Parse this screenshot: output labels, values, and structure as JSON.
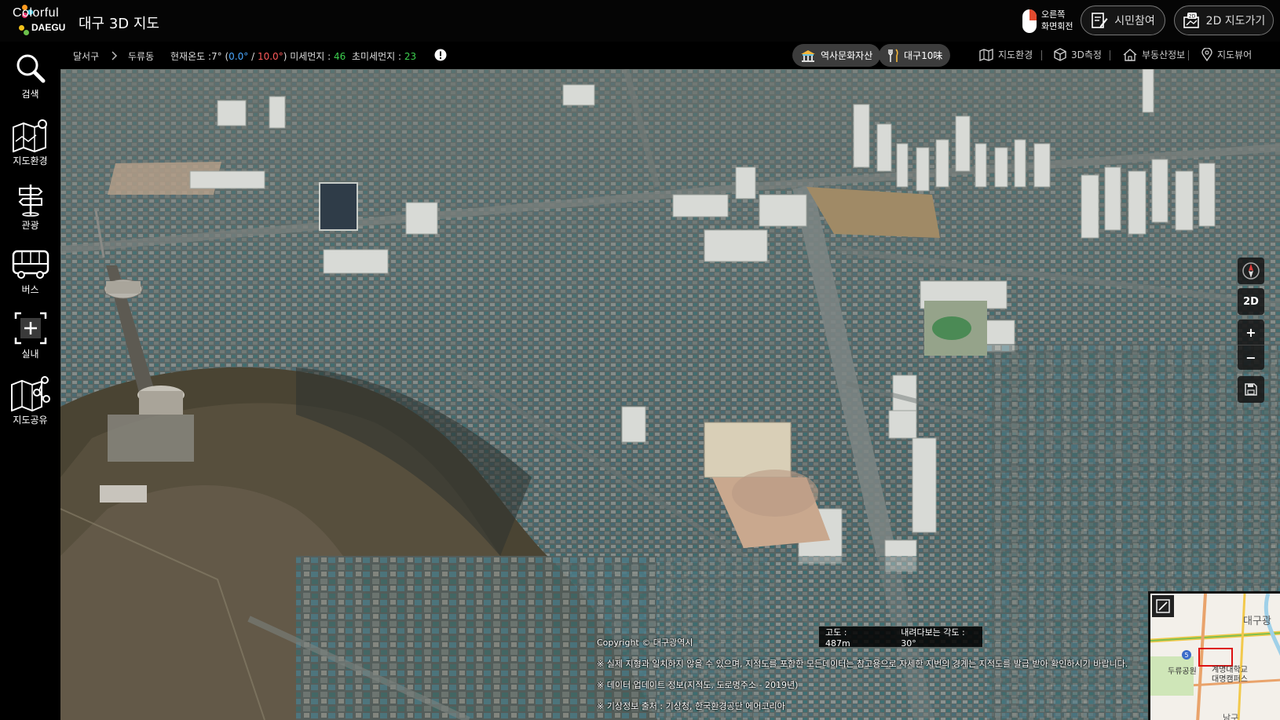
{
  "header": {
    "logo_line1": "Colorful",
    "logo_line2": "DAEGU",
    "title": "대구 3D 지도",
    "rotate_hint_line1": "오른쪽",
    "rotate_hint_line2": "화면회전",
    "citizen_button": "시민참여",
    "goto2d_button": "2D 지도가기",
    "goto2d_badge": "2D"
  },
  "sidebar": {
    "items": [
      {
        "label": "검색",
        "icon": "search-icon"
      },
      {
        "label": "지도환경",
        "icon": "map-pin-icon"
      },
      {
        "label": "관광",
        "icon": "signpost-icon"
      },
      {
        "label": "버스",
        "icon": "bus-icon"
      },
      {
        "label": "실내",
        "icon": "indoor-icon"
      },
      {
        "label": "지도공유",
        "icon": "share-map-icon"
      }
    ]
  },
  "infobar": {
    "district": "달서구",
    "dong": "두류동",
    "temp_label": "현재온도 :",
    "temp_value": "7°",
    "temp_min": "0.0°",
    "temp_slash": "/",
    "temp_max": "10.0°",
    "dust_label": "미세먼지 :",
    "dust_value": "46",
    "fine_dust_label": "초미세먼지 :",
    "fine_dust_value": "23",
    "chip_heritage": "역사문화자산",
    "chip_food": "대구10味",
    "menu": [
      {
        "label": "지도환경",
        "icon": "map-icon"
      },
      {
        "label": "3D측정",
        "icon": "cube-icon"
      },
      {
        "label": "부동산정보",
        "icon": "house-icon"
      },
      {
        "label": "지도뷰어",
        "icon": "location-pin-icon"
      }
    ]
  },
  "controls": {
    "compass": "compass-icon",
    "mode": "2D",
    "zoom_in": "+",
    "zoom_out": "−",
    "save": "save-icon"
  },
  "map_status": {
    "altitude": "고도 : 487m",
    "tilt": "내려다보는 각도 : 30°"
  },
  "notes": {
    "copyright": "Copyright © 대구광역시",
    "note1": "※ 실제 지형과 일치하지 않을 수 있으며, 지적도를 포함한 모든데이터는 참고용으로 자세한 지번의 경계는 지적도를 발급 받아 확인하시기 바랍니다.",
    "note2": "※ 데이터 업데이트 정보(지적도, 도로명주소 - 2019년)",
    "note3": "※ 기상정보 출처 : 기상청, 한국환경공단 에어코리아"
  },
  "minimap": {
    "label_region": "대구광",
    "label_park": "두류공원",
    "label_univ1": "계명대학교",
    "label_univ2": "대명캠퍼스",
    "label_south": "남구",
    "route_number": "5"
  },
  "colors": {
    "temp_min": "#4aa8ff",
    "temp_max": "#ff5a5a",
    "good": "#3ccf4e"
  }
}
